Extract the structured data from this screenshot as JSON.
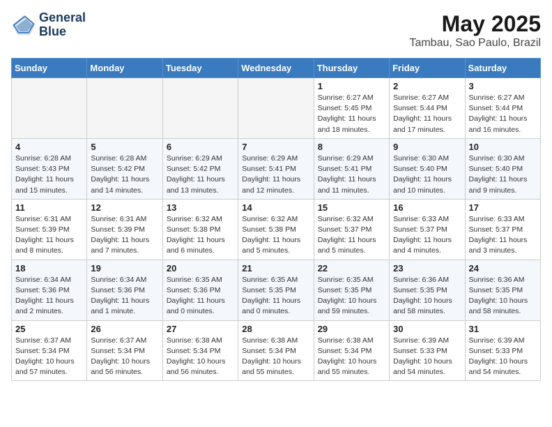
{
  "header": {
    "logo_line1": "General",
    "logo_line2": "Blue",
    "month": "May 2025",
    "location": "Tambau, Sao Paulo, Brazil"
  },
  "weekdays": [
    "Sunday",
    "Monday",
    "Tuesday",
    "Wednesday",
    "Thursday",
    "Friday",
    "Saturday"
  ],
  "weeks": [
    [
      {
        "day": "",
        "empty": true
      },
      {
        "day": "",
        "empty": true
      },
      {
        "day": "",
        "empty": true
      },
      {
        "day": "",
        "empty": true
      },
      {
        "day": "1",
        "sunrise": "Sunrise: 6:27 AM",
        "sunset": "Sunset: 5:45 PM",
        "daylight": "Daylight: 11 hours and 18 minutes."
      },
      {
        "day": "2",
        "sunrise": "Sunrise: 6:27 AM",
        "sunset": "Sunset: 5:44 PM",
        "daylight": "Daylight: 11 hours and 17 minutes."
      },
      {
        "day": "3",
        "sunrise": "Sunrise: 6:27 AM",
        "sunset": "Sunset: 5:44 PM",
        "daylight": "Daylight: 11 hours and 16 minutes."
      }
    ],
    [
      {
        "day": "4",
        "sunrise": "Sunrise: 6:28 AM",
        "sunset": "Sunset: 5:43 PM",
        "daylight": "Daylight: 11 hours and 15 minutes."
      },
      {
        "day": "5",
        "sunrise": "Sunrise: 6:28 AM",
        "sunset": "Sunset: 5:42 PM",
        "daylight": "Daylight: 11 hours and 14 minutes."
      },
      {
        "day": "6",
        "sunrise": "Sunrise: 6:29 AM",
        "sunset": "Sunset: 5:42 PM",
        "daylight": "Daylight: 11 hours and 13 minutes."
      },
      {
        "day": "7",
        "sunrise": "Sunrise: 6:29 AM",
        "sunset": "Sunset: 5:41 PM",
        "daylight": "Daylight: 11 hours and 12 minutes."
      },
      {
        "day": "8",
        "sunrise": "Sunrise: 6:29 AM",
        "sunset": "Sunset: 5:41 PM",
        "daylight": "Daylight: 11 hours and 11 minutes."
      },
      {
        "day": "9",
        "sunrise": "Sunrise: 6:30 AM",
        "sunset": "Sunset: 5:40 PM",
        "daylight": "Daylight: 11 hours and 10 minutes."
      },
      {
        "day": "10",
        "sunrise": "Sunrise: 6:30 AM",
        "sunset": "Sunset: 5:40 PM",
        "daylight": "Daylight: 11 hours and 9 minutes."
      }
    ],
    [
      {
        "day": "11",
        "sunrise": "Sunrise: 6:31 AM",
        "sunset": "Sunset: 5:39 PM",
        "daylight": "Daylight: 11 hours and 8 minutes."
      },
      {
        "day": "12",
        "sunrise": "Sunrise: 6:31 AM",
        "sunset": "Sunset: 5:39 PM",
        "daylight": "Daylight: 11 hours and 7 minutes."
      },
      {
        "day": "13",
        "sunrise": "Sunrise: 6:32 AM",
        "sunset": "Sunset: 5:38 PM",
        "daylight": "Daylight: 11 hours and 6 minutes."
      },
      {
        "day": "14",
        "sunrise": "Sunrise: 6:32 AM",
        "sunset": "Sunset: 5:38 PM",
        "daylight": "Daylight: 11 hours and 5 minutes."
      },
      {
        "day": "15",
        "sunrise": "Sunrise: 6:32 AM",
        "sunset": "Sunset: 5:37 PM",
        "daylight": "Daylight: 11 hours and 5 minutes."
      },
      {
        "day": "16",
        "sunrise": "Sunrise: 6:33 AM",
        "sunset": "Sunset: 5:37 PM",
        "daylight": "Daylight: 11 hours and 4 minutes."
      },
      {
        "day": "17",
        "sunrise": "Sunrise: 6:33 AM",
        "sunset": "Sunset: 5:37 PM",
        "daylight": "Daylight: 11 hours and 3 minutes."
      }
    ],
    [
      {
        "day": "18",
        "sunrise": "Sunrise: 6:34 AM",
        "sunset": "Sunset: 5:36 PM",
        "daylight": "Daylight: 11 hours and 2 minutes."
      },
      {
        "day": "19",
        "sunrise": "Sunrise: 6:34 AM",
        "sunset": "Sunset: 5:36 PM",
        "daylight": "Daylight: 11 hours and 1 minute."
      },
      {
        "day": "20",
        "sunrise": "Sunrise: 6:35 AM",
        "sunset": "Sunset: 5:36 PM",
        "daylight": "Daylight: 11 hours and 0 minutes."
      },
      {
        "day": "21",
        "sunrise": "Sunrise: 6:35 AM",
        "sunset": "Sunset: 5:35 PM",
        "daylight": "Daylight: 11 hours and 0 minutes."
      },
      {
        "day": "22",
        "sunrise": "Sunrise: 6:35 AM",
        "sunset": "Sunset: 5:35 PM",
        "daylight": "Daylight: 10 hours and 59 minutes."
      },
      {
        "day": "23",
        "sunrise": "Sunrise: 6:36 AM",
        "sunset": "Sunset: 5:35 PM",
        "daylight": "Daylight: 10 hours and 58 minutes."
      },
      {
        "day": "24",
        "sunrise": "Sunrise: 6:36 AM",
        "sunset": "Sunset: 5:35 PM",
        "daylight": "Daylight: 10 hours and 58 minutes."
      }
    ],
    [
      {
        "day": "25",
        "sunrise": "Sunrise: 6:37 AM",
        "sunset": "Sunset: 5:34 PM",
        "daylight": "Daylight: 10 hours and 57 minutes."
      },
      {
        "day": "26",
        "sunrise": "Sunrise: 6:37 AM",
        "sunset": "Sunset: 5:34 PM",
        "daylight": "Daylight: 10 hours and 56 minutes."
      },
      {
        "day": "27",
        "sunrise": "Sunrise: 6:38 AM",
        "sunset": "Sunset: 5:34 PM",
        "daylight": "Daylight: 10 hours and 56 minutes."
      },
      {
        "day": "28",
        "sunrise": "Sunrise: 6:38 AM",
        "sunset": "Sunset: 5:34 PM",
        "daylight": "Daylight: 10 hours and 55 minutes."
      },
      {
        "day": "29",
        "sunrise": "Sunrise: 6:38 AM",
        "sunset": "Sunset: 5:34 PM",
        "daylight": "Daylight: 10 hours and 55 minutes."
      },
      {
        "day": "30",
        "sunrise": "Sunrise: 6:39 AM",
        "sunset": "Sunset: 5:33 PM",
        "daylight": "Daylight: 10 hours and 54 minutes."
      },
      {
        "day": "31",
        "sunrise": "Sunrise: 6:39 AM",
        "sunset": "Sunset: 5:33 PM",
        "daylight": "Daylight: 10 hours and 54 minutes."
      }
    ]
  ]
}
